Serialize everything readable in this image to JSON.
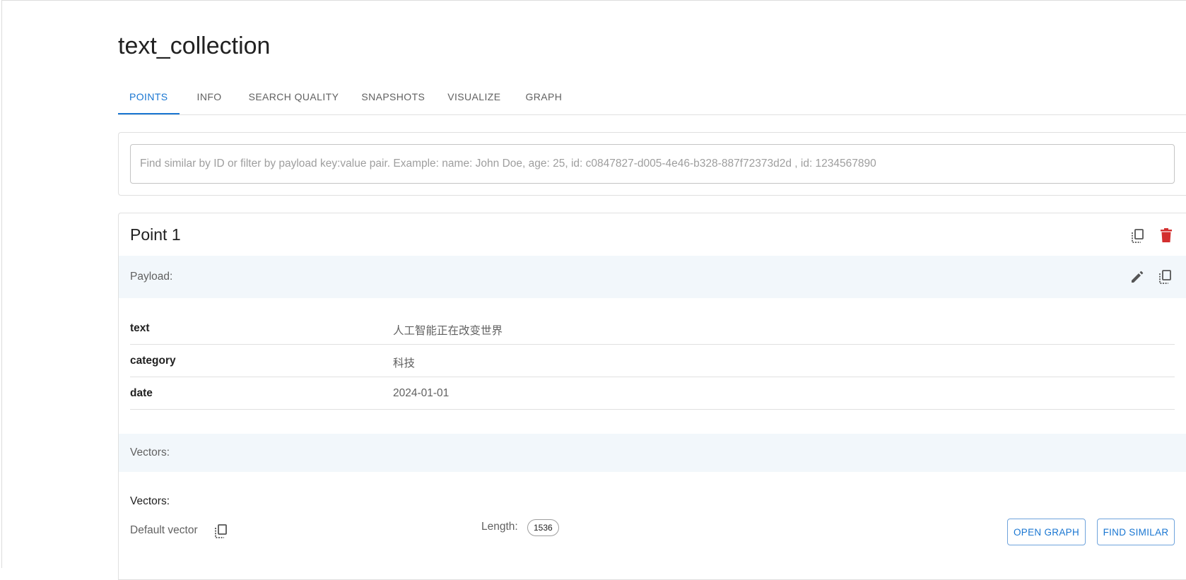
{
  "collection": {
    "title": "text_collection"
  },
  "tabs": [
    {
      "label": "POINTS",
      "active": true
    },
    {
      "label": "INFO",
      "active": false
    },
    {
      "label": "SEARCH QUALITY",
      "active": false
    },
    {
      "label": "SNAPSHOTS",
      "active": false
    },
    {
      "label": "VISUALIZE",
      "active": false
    },
    {
      "label": "GRAPH",
      "active": false
    }
  ],
  "search": {
    "placeholder": "Find similar by ID or filter by payload key:value pair. Example: name: John Doe, age: 25, id: c0847827-d005-4e46-b328-887f72373d2d , id: 1234567890",
    "value": ""
  },
  "point": {
    "title": "Point 1",
    "actions": {
      "copy_icon": "copy-icon",
      "delete_icon": "delete-icon"
    },
    "payload": {
      "label": "Payload:",
      "actions": {
        "edit_icon": "edit-icon",
        "copy_icon": "copy-icon"
      },
      "rows": [
        {
          "key": "text",
          "value": "人工智能正在改变世界"
        },
        {
          "key": "category",
          "value": "科技"
        },
        {
          "key": "date",
          "value": "2024-01-01"
        }
      ]
    },
    "vectors": {
      "band_label": "Vectors:",
      "heading": "Vectors:",
      "name": "Default vector",
      "length_label": "Length:",
      "length": "1536",
      "open_graph_label": "OPEN GRAPH",
      "find_similar_label": "FIND SIMILAR"
    }
  },
  "colors": {
    "accent": "#1976d2",
    "danger": "#d32f2f",
    "band": "#f2f7fb"
  }
}
